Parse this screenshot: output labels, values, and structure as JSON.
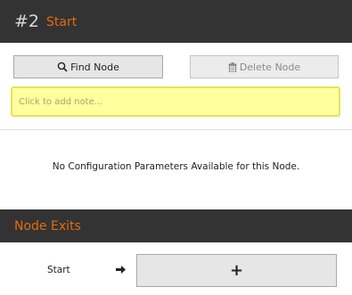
{
  "node": {
    "number": "#2",
    "name": "Start"
  },
  "toolbar": {
    "find_label": "Find Node",
    "delete_label": "Delete Node"
  },
  "note": {
    "placeholder": "Click to add note..."
  },
  "config": {
    "empty_message": "No Configuration Parameters Available for this Node."
  },
  "exits": {
    "title": "Node Exits",
    "items": [
      {
        "label": "Start",
        "add_symbol": "+"
      }
    ]
  },
  "colors": {
    "header_bg": "#333333",
    "accent": "#e46c0a",
    "note_bg": "#ffff9e"
  },
  "icons": {
    "find": "search-icon",
    "delete": "trash-icon",
    "exit": "arrow-right-icon"
  }
}
